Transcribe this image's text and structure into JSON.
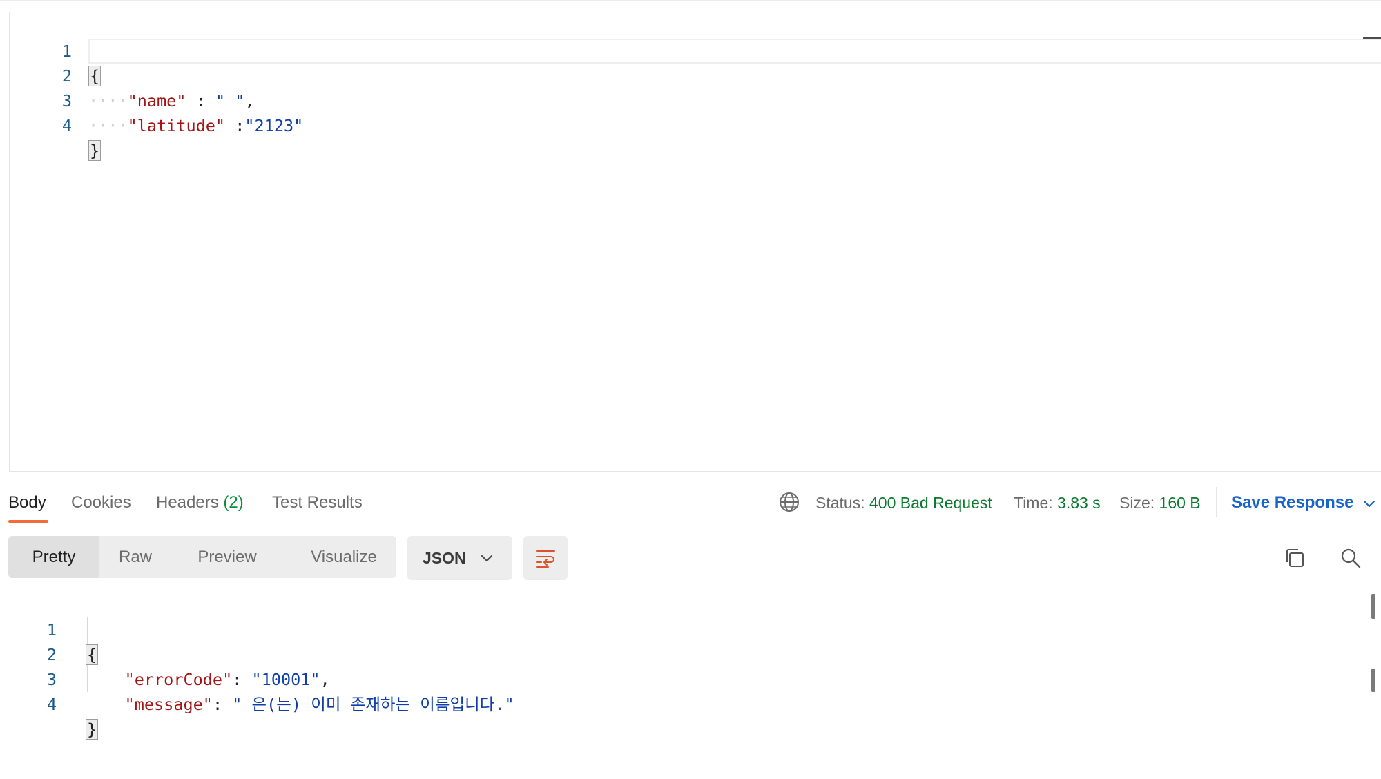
{
  "request_body": {
    "lines": [
      {
        "num": "1",
        "open": "{"
      },
      {
        "num": "2",
        "key": "\"name\"",
        "sep": " : ",
        "value": "\" \"",
        "trail": ","
      },
      {
        "num": "3",
        "key": "\"latitude\"",
        "sep": " :",
        "value": "\"2123\"",
        "trail": ""
      },
      {
        "num": "4",
        "close": "}"
      }
    ]
  },
  "response_tabs": {
    "body": "Body",
    "cookies": "Cookies",
    "headers": "Headers",
    "headers_count": "(2)",
    "test_results": "Test Results"
  },
  "status": {
    "status_label": "Status:",
    "status_value": "400 Bad Request",
    "time_label": "Time:",
    "time_value": "3.83 s",
    "size_label": "Size:",
    "size_value": "160 B",
    "save_response": "Save Response"
  },
  "view_modes": {
    "pretty": "Pretty",
    "raw": "Raw",
    "preview": "Preview",
    "visualize": "Visualize",
    "format": "JSON"
  },
  "response_body": {
    "lines": [
      {
        "num": "1",
        "open": "{"
      },
      {
        "num": "2",
        "key": "\"errorCode\"",
        "sep": ": ",
        "value": "\"10001\"",
        "trail": ","
      },
      {
        "num": "3",
        "key": "\"message\"",
        "sep": ": ",
        "value": "\" 은(는) 이미 존재하는 이름입니다.\"",
        "trail": ""
      },
      {
        "num": "4",
        "close": "}"
      }
    ]
  },
  "icons": [
    "globe-icon",
    "chevron-down-icon",
    "wrap-lines-icon",
    "copy-icon",
    "search-icon"
  ],
  "colors": {
    "accent_underline": "#f26b3a",
    "status_green": "#0b7a2e",
    "link_blue": "#1a63c9",
    "json_key": "#a31515",
    "json_string": "#0f3ea8"
  }
}
